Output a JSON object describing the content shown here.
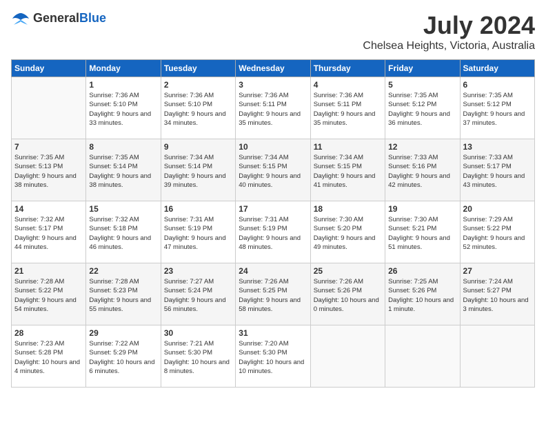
{
  "logo": {
    "general": "General",
    "blue": "Blue"
  },
  "title": "July 2024",
  "subtitle": "Chelsea Heights, Victoria, Australia",
  "days_header": [
    "Sunday",
    "Monday",
    "Tuesday",
    "Wednesday",
    "Thursday",
    "Friday",
    "Saturday"
  ],
  "weeks": [
    [
      {
        "num": "",
        "sunrise": "",
        "sunset": "",
        "daylight": ""
      },
      {
        "num": "1",
        "sunrise": "Sunrise: 7:36 AM",
        "sunset": "Sunset: 5:10 PM",
        "daylight": "Daylight: 9 hours and 33 minutes."
      },
      {
        "num": "2",
        "sunrise": "Sunrise: 7:36 AM",
        "sunset": "Sunset: 5:10 PM",
        "daylight": "Daylight: 9 hours and 34 minutes."
      },
      {
        "num": "3",
        "sunrise": "Sunrise: 7:36 AM",
        "sunset": "Sunset: 5:11 PM",
        "daylight": "Daylight: 9 hours and 35 minutes."
      },
      {
        "num": "4",
        "sunrise": "Sunrise: 7:36 AM",
        "sunset": "Sunset: 5:11 PM",
        "daylight": "Daylight: 9 hours and 35 minutes."
      },
      {
        "num": "5",
        "sunrise": "Sunrise: 7:35 AM",
        "sunset": "Sunset: 5:12 PM",
        "daylight": "Daylight: 9 hours and 36 minutes."
      },
      {
        "num": "6",
        "sunrise": "Sunrise: 7:35 AM",
        "sunset": "Sunset: 5:12 PM",
        "daylight": "Daylight: 9 hours and 37 minutes."
      }
    ],
    [
      {
        "num": "7",
        "sunrise": "Sunrise: 7:35 AM",
        "sunset": "Sunset: 5:13 PM",
        "daylight": "Daylight: 9 hours and 38 minutes."
      },
      {
        "num": "8",
        "sunrise": "Sunrise: 7:35 AM",
        "sunset": "Sunset: 5:14 PM",
        "daylight": "Daylight: 9 hours and 38 minutes."
      },
      {
        "num": "9",
        "sunrise": "Sunrise: 7:34 AM",
        "sunset": "Sunset: 5:14 PM",
        "daylight": "Daylight: 9 hours and 39 minutes."
      },
      {
        "num": "10",
        "sunrise": "Sunrise: 7:34 AM",
        "sunset": "Sunset: 5:15 PM",
        "daylight": "Daylight: 9 hours and 40 minutes."
      },
      {
        "num": "11",
        "sunrise": "Sunrise: 7:34 AM",
        "sunset": "Sunset: 5:15 PM",
        "daylight": "Daylight: 9 hours and 41 minutes."
      },
      {
        "num": "12",
        "sunrise": "Sunrise: 7:33 AM",
        "sunset": "Sunset: 5:16 PM",
        "daylight": "Daylight: 9 hours and 42 minutes."
      },
      {
        "num": "13",
        "sunrise": "Sunrise: 7:33 AM",
        "sunset": "Sunset: 5:17 PM",
        "daylight": "Daylight: 9 hours and 43 minutes."
      }
    ],
    [
      {
        "num": "14",
        "sunrise": "Sunrise: 7:32 AM",
        "sunset": "Sunset: 5:17 PM",
        "daylight": "Daylight: 9 hours and 44 minutes."
      },
      {
        "num": "15",
        "sunrise": "Sunrise: 7:32 AM",
        "sunset": "Sunset: 5:18 PM",
        "daylight": "Daylight: 9 hours and 46 minutes."
      },
      {
        "num": "16",
        "sunrise": "Sunrise: 7:31 AM",
        "sunset": "Sunset: 5:19 PM",
        "daylight": "Daylight: 9 hours and 47 minutes."
      },
      {
        "num": "17",
        "sunrise": "Sunrise: 7:31 AM",
        "sunset": "Sunset: 5:19 PM",
        "daylight": "Daylight: 9 hours and 48 minutes."
      },
      {
        "num": "18",
        "sunrise": "Sunrise: 7:30 AM",
        "sunset": "Sunset: 5:20 PM",
        "daylight": "Daylight: 9 hours and 49 minutes."
      },
      {
        "num": "19",
        "sunrise": "Sunrise: 7:30 AM",
        "sunset": "Sunset: 5:21 PM",
        "daylight": "Daylight: 9 hours and 51 minutes."
      },
      {
        "num": "20",
        "sunrise": "Sunrise: 7:29 AM",
        "sunset": "Sunset: 5:22 PM",
        "daylight": "Daylight: 9 hours and 52 minutes."
      }
    ],
    [
      {
        "num": "21",
        "sunrise": "Sunrise: 7:28 AM",
        "sunset": "Sunset: 5:22 PM",
        "daylight": "Daylight: 9 hours and 54 minutes."
      },
      {
        "num": "22",
        "sunrise": "Sunrise: 7:28 AM",
        "sunset": "Sunset: 5:23 PM",
        "daylight": "Daylight: 9 hours and 55 minutes."
      },
      {
        "num": "23",
        "sunrise": "Sunrise: 7:27 AM",
        "sunset": "Sunset: 5:24 PM",
        "daylight": "Daylight: 9 hours and 56 minutes."
      },
      {
        "num": "24",
        "sunrise": "Sunrise: 7:26 AM",
        "sunset": "Sunset: 5:25 PM",
        "daylight": "Daylight: 9 hours and 58 minutes."
      },
      {
        "num": "25",
        "sunrise": "Sunrise: 7:26 AM",
        "sunset": "Sunset: 5:26 PM",
        "daylight": "Daylight: 10 hours and 0 minutes."
      },
      {
        "num": "26",
        "sunrise": "Sunrise: 7:25 AM",
        "sunset": "Sunset: 5:26 PM",
        "daylight": "Daylight: 10 hours and 1 minute."
      },
      {
        "num": "27",
        "sunrise": "Sunrise: 7:24 AM",
        "sunset": "Sunset: 5:27 PM",
        "daylight": "Daylight: 10 hours and 3 minutes."
      }
    ],
    [
      {
        "num": "28",
        "sunrise": "Sunrise: 7:23 AM",
        "sunset": "Sunset: 5:28 PM",
        "daylight": "Daylight: 10 hours and 4 minutes."
      },
      {
        "num": "29",
        "sunrise": "Sunrise: 7:22 AM",
        "sunset": "Sunset: 5:29 PM",
        "daylight": "Daylight: 10 hours and 6 minutes."
      },
      {
        "num": "30",
        "sunrise": "Sunrise: 7:21 AM",
        "sunset": "Sunset: 5:30 PM",
        "daylight": "Daylight: 10 hours and 8 minutes."
      },
      {
        "num": "31",
        "sunrise": "Sunrise: 7:20 AM",
        "sunset": "Sunset: 5:30 PM",
        "daylight": "Daylight: 10 hours and 10 minutes."
      },
      {
        "num": "",
        "sunrise": "",
        "sunset": "",
        "daylight": ""
      },
      {
        "num": "",
        "sunrise": "",
        "sunset": "",
        "daylight": ""
      },
      {
        "num": "",
        "sunrise": "",
        "sunset": "",
        "daylight": ""
      }
    ]
  ]
}
